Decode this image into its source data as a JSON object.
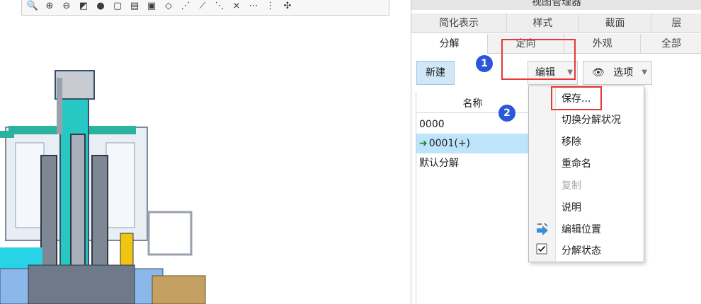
{
  "panel": {
    "title": "视图管理器",
    "tabs_row1": [
      "简化表示",
      "样式",
      "截面",
      "层"
    ],
    "tabs_row2": [
      "分解",
      "定向",
      "外观",
      "全部"
    ],
    "active_tab": "分解"
  },
  "buttons": {
    "new_label": "新建",
    "edit_label": "编辑",
    "options_label": "选项"
  },
  "list": {
    "header": "名称",
    "items": [
      "0000",
      "0001(+)",
      "默认分解"
    ],
    "selected_index": 1
  },
  "menu": {
    "items": [
      {
        "label": "保存...",
        "enabled": true
      },
      {
        "label": "切换分解状况",
        "enabled": true
      },
      {
        "label": "移除",
        "enabled": true
      },
      {
        "label": "重命名",
        "enabled": true
      },
      {
        "label": "复制",
        "enabled": false
      },
      {
        "label": "说明",
        "enabled": true
      },
      {
        "label": "编辑位置",
        "enabled": true,
        "icon": "edit-position-icon"
      },
      {
        "label": "分解状态",
        "enabled": true,
        "checked": true
      }
    ]
  },
  "annotations": {
    "step1": "1",
    "step2": "2"
  },
  "colors": {
    "accent": "#2b57d9",
    "highlight": "#e53935",
    "selection": "#bde4fb"
  }
}
